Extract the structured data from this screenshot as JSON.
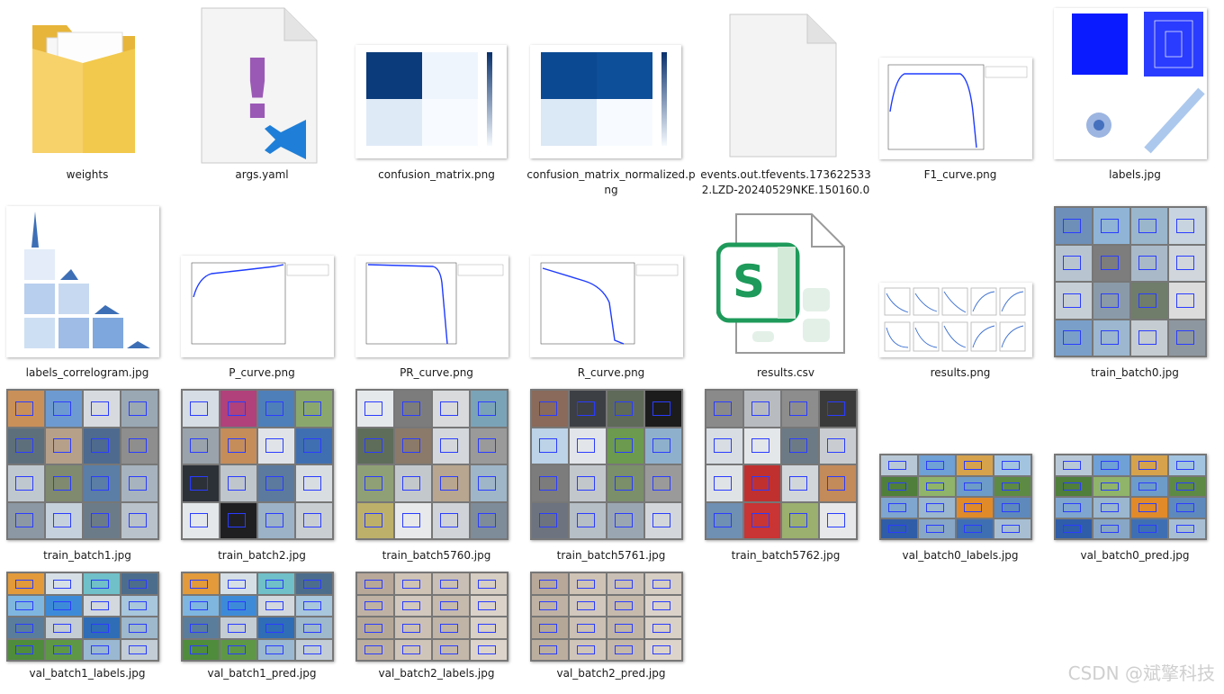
{
  "files": [
    {
      "name": "weights",
      "kind": "folder"
    },
    {
      "name": "args.yaml",
      "kind": "yaml"
    },
    {
      "name": "confusion_matrix.png",
      "kind": "confusion"
    },
    {
      "name": "confusion_matrix_normalized.png",
      "kind": "confusion_norm"
    },
    {
      "name": "events.out.tfevents.1736225332.LZD-20240529NKE.150160.0",
      "kind": "blank"
    },
    {
      "name": "F1_curve.png",
      "kind": "f1"
    },
    {
      "name": "labels.jpg",
      "kind": "labels"
    },
    {
      "name": "labels_correlogram.jpg",
      "kind": "correlogram"
    },
    {
      "name": "P_curve.png",
      "kind": "p"
    },
    {
      "name": "PR_curve.png",
      "kind": "pr"
    },
    {
      "name": "R_curve.png",
      "kind": "r"
    },
    {
      "name": "results.csv",
      "kind": "csv"
    },
    {
      "name": "results.png",
      "kind": "results"
    },
    {
      "name": "train_batch0.jpg",
      "kind": "mosaic"
    },
    {
      "name": "train_batch1.jpg",
      "kind": "mosaic"
    },
    {
      "name": "train_batch2.jpg",
      "kind": "mosaic"
    },
    {
      "name": "train_batch5760.jpg",
      "kind": "mosaic"
    },
    {
      "name": "train_batch5761.jpg",
      "kind": "mosaic"
    },
    {
      "name": "train_batch5762.jpg",
      "kind": "mosaic"
    },
    {
      "name": "val_batch0_labels.jpg",
      "kind": "valmosaic"
    },
    {
      "name": "val_batch0_pred.jpg",
      "kind": "valmosaic"
    },
    {
      "name": "val_batch1_labels.jpg",
      "kind": "valmosaic"
    },
    {
      "name": "val_batch1_pred.jpg",
      "kind": "valmosaic"
    },
    {
      "name": "val_batch2_labels.jpg",
      "kind": "valmosaic2"
    },
    {
      "name": "val_batch2_pred.jpg",
      "kind": "valmosaic2"
    }
  ],
  "icons": {
    "yaml_glyph": "!",
    "csv_glyph": "S",
    "accent_blue": "#1e5dff",
    "vscode_blue": "#1f7fd8",
    "csv_green": "#1e9a5a",
    "folder_yellow": "#f2c94c"
  },
  "watermark": "CSDN @斌擎科技"
}
